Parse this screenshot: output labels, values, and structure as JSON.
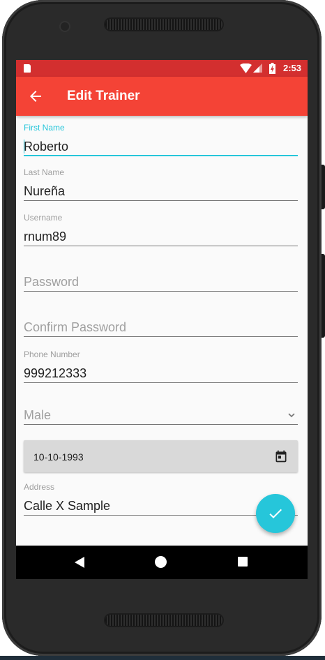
{
  "status_bar": {
    "time": "2:53"
  },
  "toolbar": {
    "title": "Edit Trainer",
    "back_icon": "arrow-back-icon"
  },
  "form": {
    "first_name": {
      "label": "First Name",
      "value": "Roberto"
    },
    "last_name": {
      "label": "Last Name",
      "value": "Nureña"
    },
    "username": {
      "label": "Username",
      "value": "rnum89"
    },
    "password": {
      "placeholder": "Password"
    },
    "confirm_password": {
      "placeholder": "Confirm Password"
    },
    "phone": {
      "label": "Phone Number",
      "value": "999212333"
    },
    "gender": {
      "selected": "Male"
    },
    "birth_date": {
      "value": "10-10-1993",
      "icon": "calendar-icon"
    },
    "address": {
      "label": "Address",
      "value": "Calle X Sample"
    }
  },
  "fab": {
    "icon": "check-icon"
  },
  "colors": {
    "status_bar": "#d32f2f",
    "toolbar": "#f44336",
    "accent": "#26c6da",
    "background": "#fafafa"
  }
}
